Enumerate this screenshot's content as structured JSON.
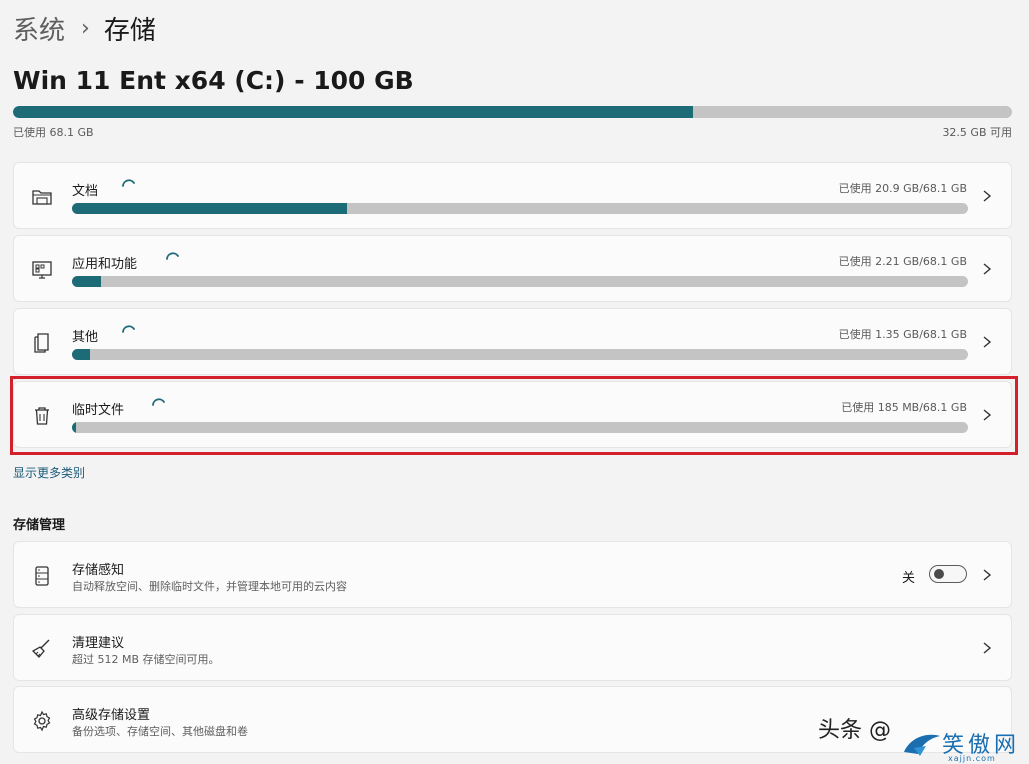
{
  "breadcrumb": {
    "parent": "系统",
    "separator": "›",
    "current": "存储"
  },
  "drive": {
    "title": "Win 11 Ent x64 (C:) - 100 GB",
    "used_label": "已使用 68.1 GB",
    "free_label": "32.5 GB 可用",
    "used_fraction": 0.681
  },
  "categories": [
    {
      "label": "文档",
      "usage": "已使用 20.9 GB/68.1 GB",
      "fraction": 0.307,
      "icon": "folder-icon"
    },
    {
      "label": "应用和功能",
      "usage": "已使用 2.21 GB/68.1 GB",
      "fraction": 0.032,
      "icon": "apps-icon"
    },
    {
      "label": "其他",
      "usage": "已使用 1.35 GB/68.1 GB",
      "fraction": 0.02,
      "icon": "document-stack-icon"
    },
    {
      "label": "临时文件",
      "usage": "已使用 185 MB/68.1 GB",
      "fraction": 0.003,
      "icon": "trash-icon"
    }
  ],
  "show_more": "显示更多类别",
  "management": {
    "title": "存储管理",
    "items": [
      {
        "label": "存储感知",
        "description": "自动释放空间、删除临时文件，并管理本地可用的云内容",
        "toggle_label": "关",
        "toggle_on": false,
        "icon": "storage-sense-icon"
      },
      {
        "label": "清理建议",
        "description": "超过 512 MB 存储空间可用。",
        "icon": "broom-icon"
      },
      {
        "label": "高级存储设置",
        "description": "备份选项、存储空间、其他磁盘和卷",
        "icon": "gear-icon"
      }
    ]
  },
  "watermark": {
    "text": "头条 @",
    "site": "xajjn.com"
  },
  "colors": {
    "accent": "#1e6b78",
    "track": "#c4c4c4",
    "highlight": "#d3202a"
  }
}
